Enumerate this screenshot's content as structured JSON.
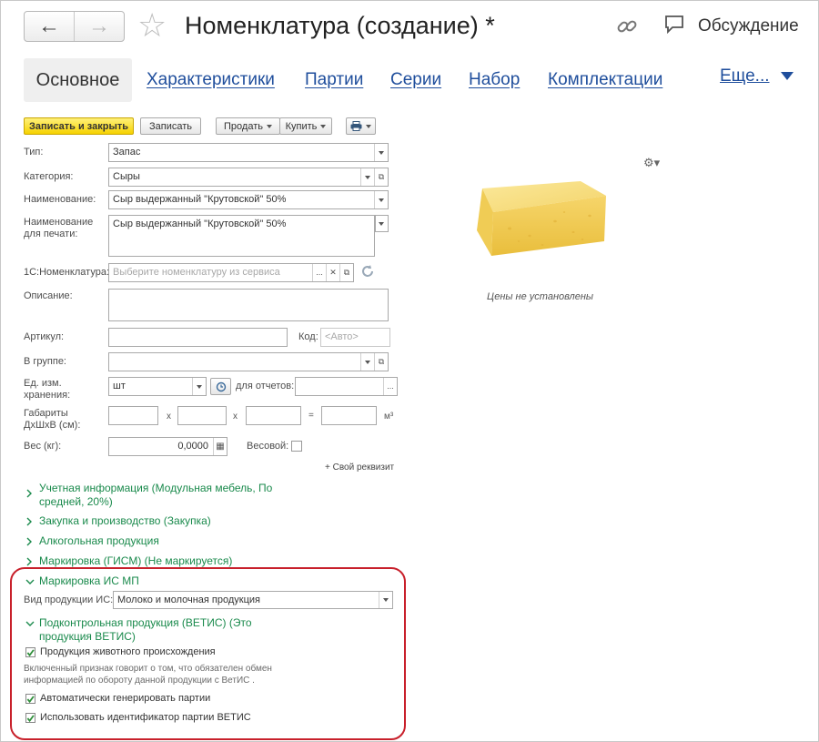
{
  "header": {
    "title": "Номенклатура (создание) *",
    "back_icon": "←",
    "forward_icon": "→",
    "discussion": "Обсуждение"
  },
  "tabs": {
    "active": "Основное",
    "items": [
      "Характеристики",
      "Партии",
      "Серии",
      "Набор",
      "Комплектации"
    ],
    "more": "Еще..."
  },
  "toolbar": {
    "save_close": "Записать и закрыть",
    "save": "Записать",
    "sell": "Продать",
    "buy": "Купить"
  },
  "form": {
    "type_label": "Тип:",
    "type_value": "Запас",
    "category_label": "Категория:",
    "category_value": "Сыры",
    "name_label": "Наименование:",
    "name_value": "Сыр выдержанный \"Крутовской\" 50%",
    "print_name_label_1": "Наименование",
    "print_name_label_2": "для печати:",
    "print_name_value": "Сыр выдержанный \"Крутовской\" 50%",
    "catalog_label": "1С:Номенклатура:",
    "catalog_placeholder": "Выберите номенклатуру из сервиса",
    "description_label": "Описание:",
    "article_label": "Артикул:",
    "code_label": "Код:",
    "code_placeholder": "<Авто>",
    "group_label": "В группе:",
    "unit_label_1": "Ед. изм.",
    "unit_label_2": "хранения:",
    "unit_value": "шт",
    "reports_label": "для отчетов:",
    "dims_label_1": "Габариты",
    "dims_label_2": "ДхШхВ (см):",
    "dims_x": "x",
    "dims_eq": "=",
    "dims_unit": "м³",
    "weight_label": "Вес (кг):",
    "weight_value": "0,0000",
    "weighted_label": "Весовой:",
    "add_requisite": "+ Свой реквизит"
  },
  "image_panel": {
    "prices_note": "Цены не установлены"
  },
  "sections": {
    "accounting_1": "Учетная информация (Модульная мебель, По",
    "accounting_2": "средней, 20%)",
    "purchase": "Закупка и производство (Закупка)",
    "alcohol": "Алкогольная продукция",
    "gism": "Маркировка (ГИСМ) (Не маркируется)",
    "ismp": "Маркировка ИС МП",
    "vetis_1": "Подконтрольная продукция (ВЕТИС) (Это",
    "vetis_2": "продукция ВЕТИС)"
  },
  "ismp": {
    "product_type_label": "Вид продукции ИС:",
    "product_type_value": "Молоко и молочная продукция"
  },
  "vetis": {
    "animal_origin": "Продукция животного происхождения",
    "animal_origin_checked": true,
    "note_1": "Включенный признак говорит о том, что обязателен обмен",
    "note_2": "информацией по обороту данной продукции с ВетИС .",
    "auto_batches": "Автоматически генерировать партии",
    "auto_batches_checked": true,
    "use_batch_id": "Использовать идентификатор партии ВЕТИС",
    "use_batch_id_checked": true
  },
  "colors": {
    "link": "#1f4e9c",
    "section_green": "#1a8a4c",
    "highlight_red": "#c8202b",
    "primary_yellow": "#f6d200"
  }
}
